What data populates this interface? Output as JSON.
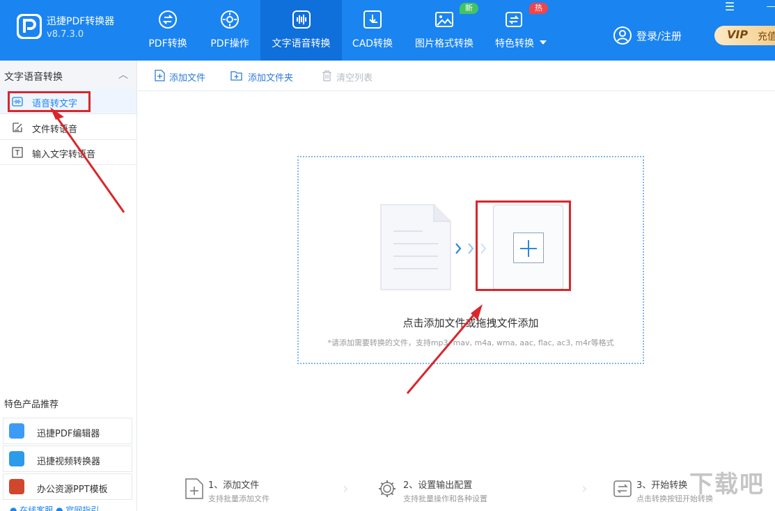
{
  "app": {
    "name": "迅捷PDF转换器",
    "version": "v8.7.3.0"
  },
  "nav": [
    {
      "label": "PDF转换",
      "icon": "pdf-convert-icon"
    },
    {
      "label": "PDF操作",
      "icon": "pdf-operate-icon"
    },
    {
      "label": "文字语音转换",
      "icon": "audio-wave-icon",
      "active": true
    },
    {
      "label": "CAD转换",
      "icon": "cad-icon"
    },
    {
      "label": "图片格式转换",
      "icon": "image-icon",
      "badge": "新"
    },
    {
      "label": "特色转换",
      "icon": "feature-convert-icon",
      "badge": "热"
    }
  ],
  "window": {
    "menu": "☰",
    "minimize": "—"
  },
  "account": {
    "login": "登录/注册",
    "vip": "VIP",
    "vip_charge": "充值"
  },
  "sidebar": {
    "title": "文字语音转换",
    "items": [
      {
        "label": "语音转文字",
        "active": true
      },
      {
        "label": "文件转语音"
      },
      {
        "label": "输入文字转语音"
      }
    ],
    "recommend_title": "特色产品推荐",
    "recommend": [
      {
        "label": "迅捷PDF编辑器"
      },
      {
        "label": "迅捷视频转换器"
      },
      {
        "label": "办公资源PPT模板"
      }
    ],
    "footer": "● 在线客服     ● 官网指引"
  },
  "toolbar": {
    "add_file": "添加文件",
    "add_folder": "添加文件夹",
    "clear_list": "清空列表"
  },
  "dropzone": {
    "main_text": "点击添加文件或拖拽文件添加",
    "sub_text": "*请添加需要转换的文件，支持mp3, mav, m4a, wma, aac, flac, ac3, m4r等格式"
  },
  "steps": [
    {
      "title": "1、添加文件",
      "desc": "支持批量添加文件"
    },
    {
      "title": "2、设置输出配置",
      "desc": "支持批量操作和各种设置"
    },
    {
      "title": "3、开始转换",
      "desc": "点击转换按钮开始转换"
    }
  ],
  "watermark": "下载吧",
  "colors": {
    "brand": "#1a84f1",
    "active_tab": "#0f6fdb",
    "annotation": "#d9262b"
  }
}
